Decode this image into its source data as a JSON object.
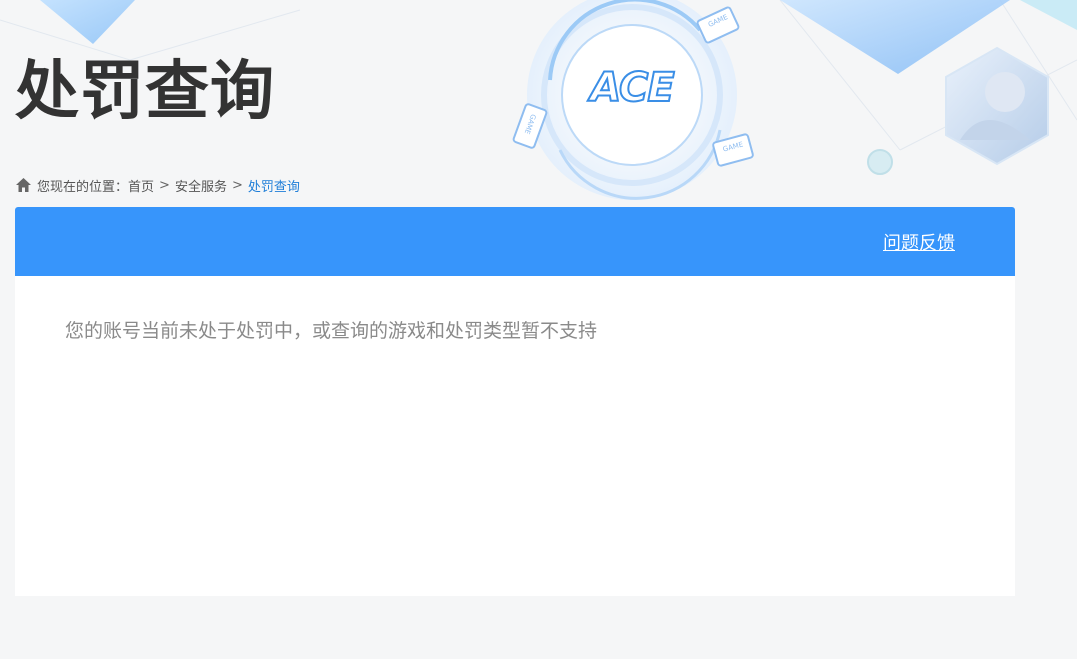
{
  "page": {
    "title": "处罚查询"
  },
  "breadcrumb": {
    "prefix": "您现在的位置：",
    "items": [
      "首页",
      "安全服务"
    ],
    "separator": ">",
    "current": "处罚查询"
  },
  "card": {
    "feedback_label": "问题反馈",
    "notice": "您的账号当前未处于处罚中，或查询的游戏和处罚类型暂不支持"
  },
  "banner": {
    "logo_text": "ACE",
    "badge_text": "GAME"
  },
  "colors": {
    "accent": "#3795fb",
    "title": "#333333",
    "link_current": "#1e7ed8",
    "notice": "#8a8a8a",
    "background": "#f5f6f7"
  }
}
